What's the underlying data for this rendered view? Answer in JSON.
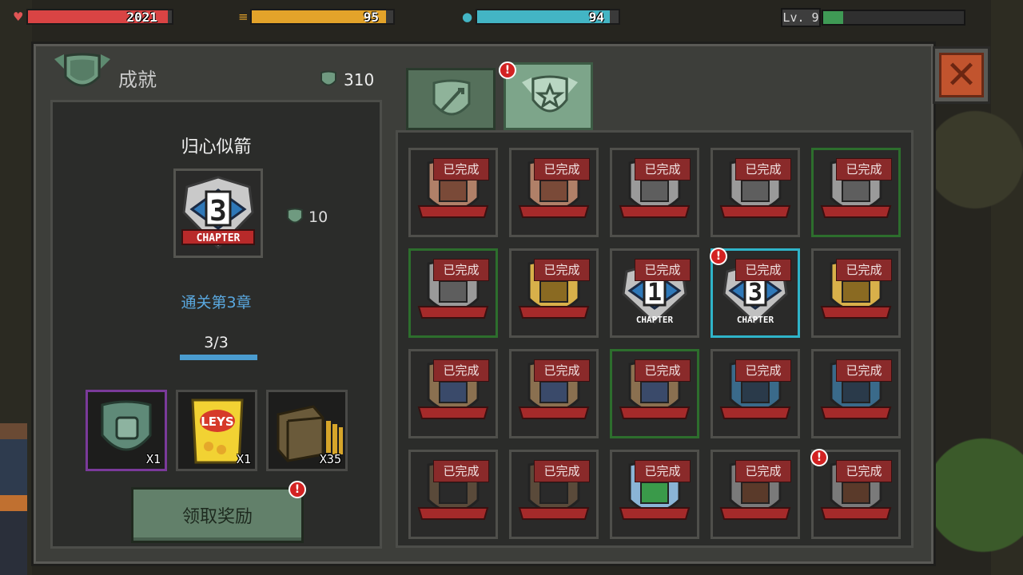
{
  "hud": {
    "health": {
      "value": "2021",
      "fill": 0.97,
      "color": "#d94444"
    },
    "food": {
      "value": "95",
      "fill": 0.95,
      "color": "#e3a32a"
    },
    "water": {
      "value": "94",
      "fill": 0.94,
      "color": "#43b5c4"
    },
    "level": {
      "label": "Lv. 9",
      "xp_fill": 0.14
    }
  },
  "panel": {
    "title": "成就",
    "points": "310",
    "close_icon": "close-x-icon"
  },
  "tabs": [
    {
      "icon": "sword-shield-icon",
      "active": false
    },
    {
      "icon": "star-shield-icon",
      "active": true,
      "alert": "!"
    }
  ],
  "detail": {
    "name": "归心似箭",
    "badge_number": "3",
    "badge_caption": "CHAPTER",
    "badge_points": "10",
    "description": "通关第3章",
    "progress": "3/3",
    "progress_fill": 1.0,
    "rewards": [
      {
        "icon": "fist-shield-icon",
        "qty": "X1"
      },
      {
        "icon": "chips-bag-icon",
        "label": "LEYS",
        "qty": "X1"
      },
      {
        "icon": "ammo-crate-icon",
        "qty": "X35"
      }
    ],
    "claim_label": "领取奖励",
    "claim_alert": "!"
  },
  "grid": {
    "done_label": "已完成",
    "rows": [
      [
        {
          "badge": "bronze-shield",
          "tint": "bronze"
        },
        {
          "badge": "bronze-shield",
          "tint": "bronze"
        },
        {
          "badge": "silver-shield",
          "tint": "silver"
        },
        {
          "badge": "silver-shield",
          "tint": "silver"
        },
        {
          "badge": "silver-shield",
          "tint": "silver",
          "frame": "green"
        }
      ],
      [
        {
          "badge": "silver-shield",
          "tint": "silver",
          "frame": "green"
        },
        {
          "badge": "gold-star-shield",
          "tint": "gold"
        },
        {
          "badge": "chapter-badge",
          "number": "1",
          "caption": "CHAPTER"
        },
        {
          "badge": "chapter-badge",
          "number": "3",
          "caption": "CHAPTER",
          "frame": "selected",
          "alert": "!"
        },
        {
          "badge": "laurel-handshake",
          "tint": "gold"
        }
      ],
      [
        {
          "badge": "crate-barrel",
          "tint": "crate"
        },
        {
          "badge": "crate-barrel",
          "tint": "crate"
        },
        {
          "badge": "crate-barrel",
          "tint": "crate",
          "frame": "green"
        },
        {
          "badge": "car",
          "tint": "car"
        },
        {
          "badge": "car",
          "tint": "car"
        }
      ],
      [
        {
          "badge": "boots",
          "tint": "boots"
        },
        {
          "badge": "boots",
          "tint": "boots"
        },
        {
          "badge": "magnifier-check",
          "tint": "magnifier"
        },
        {
          "badge": "crossed-tools",
          "tint": "tools"
        },
        {
          "badge": "crossed-tools",
          "tint": "tools",
          "alert": "!"
        }
      ]
    ]
  }
}
